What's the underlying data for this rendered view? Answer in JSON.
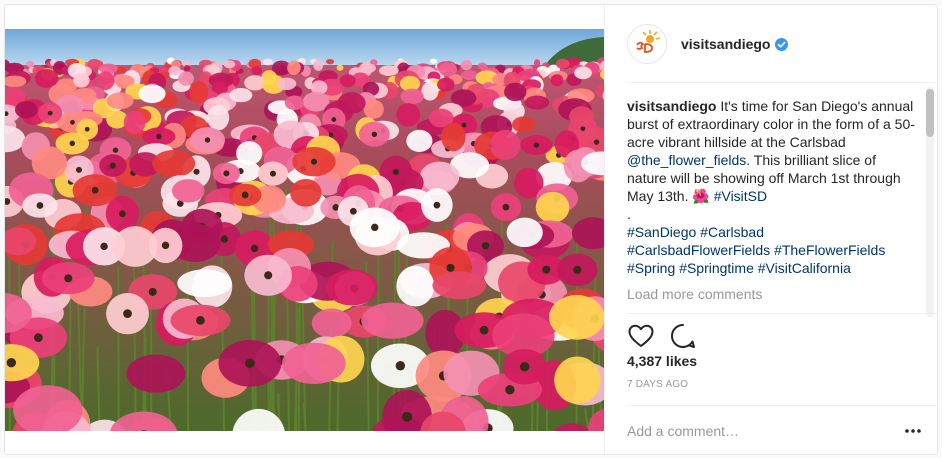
{
  "post": {
    "username": "visitsandiego",
    "avatar_text": "San Diego",
    "caption": {
      "user": "visitsandiego",
      "text_1": "It's time for San Diego's annual burst of extraordinary color in the form of a 50-acre vibrant hillside at the Carlsbad",
      "mention": "@the_flower_fields",
      "text_2": ". This brilliant slice of nature will be showing off March 1st through May 13th.",
      "emoji": "🌺",
      "hashtag_first": "#VisitSD",
      "dot": ".",
      "hashtags": [
        "#SanDiego",
        "#Carlsbad",
        "#CarlsbadFlowerFields",
        "#TheFlowerFields",
        "#Spring",
        "#Springtime",
        "#VisitCalifornia"
      ]
    },
    "load_more": "Load more comments",
    "likes": "4,387 likes",
    "timestamp": "7 DAYS AGO",
    "comment_placeholder": "Add a comment…",
    "more_label": "•••"
  },
  "colors": {
    "link": "#003569",
    "muted": "#999999",
    "verified": "#3897f0",
    "text": "#262626"
  },
  "icons": [
    "verified-icon",
    "heart-icon",
    "comment-icon",
    "more-options-icon"
  ]
}
